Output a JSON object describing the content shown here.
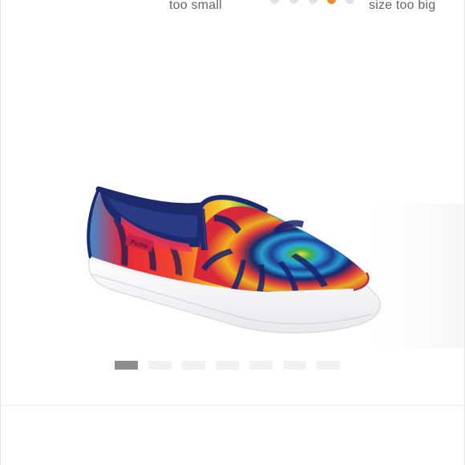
{
  "fit_scale": {
    "left_label": "too small",
    "right_label": "size too big",
    "dot_count": 5,
    "selected_index": 3,
    "selected_color": "#f08a2c"
  },
  "product_image": {
    "brand_label": "Puma",
    "subject": "tie-dye slip-on sneaker"
  },
  "carousel": {
    "count": 7,
    "active_index": 0
  },
  "colors": {
    "sole": "#ffffff",
    "trim": "#1f2a6b"
  }
}
